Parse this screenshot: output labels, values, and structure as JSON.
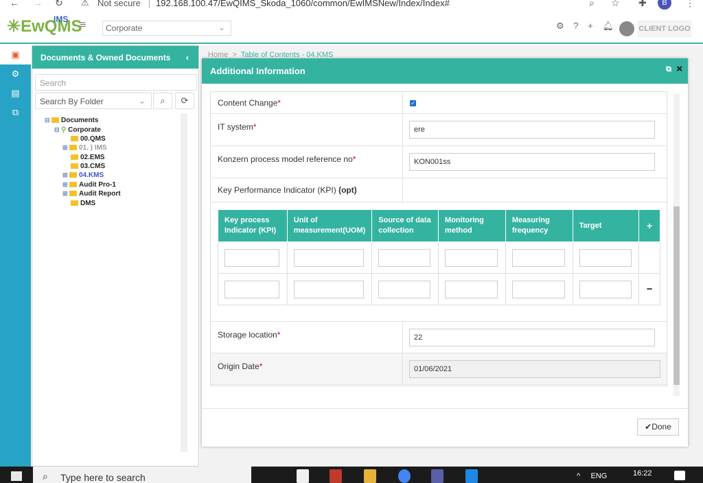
{
  "browser": {
    "back_icon": "←",
    "forward_icon": "→",
    "reload_icon": "↻",
    "security_label": "Not secure",
    "url": "192.168.100.47/EwQIMS_Skoda_1060/common/EwIMSNew/Index/Index#",
    "profile_initial": "B"
  },
  "header": {
    "logo_text": "EwQMS",
    "logo_sup": "IMS",
    "org_select": "Corporate",
    "client_logo": "CLIENT LOGO"
  },
  "docpanel": {
    "title": "Documents & Owned Documents",
    "search_placeholder": "Search",
    "folder_select": "Search By Folder",
    "tree": [
      {
        "label": "Documents"
      },
      {
        "label": "Corporate"
      },
      {
        "label": "00.QMS"
      },
      {
        "label": "01. ) IMS"
      },
      {
        "label": "02.EMS"
      },
      {
        "label": "03.CMS"
      },
      {
        "label": "04.KMS"
      },
      {
        "label": "Audit Pro-1"
      },
      {
        "label": "Audit Report"
      },
      {
        "label": "DMS"
      }
    ]
  },
  "background": {
    "crumb_home": "Home",
    "crumb_sep": ">",
    "crumb_current": "Table of Contents - 04.KMS"
  },
  "modal": {
    "title": "Additional Information",
    "close": "×",
    "fields": {
      "content_change": {
        "label": "Content Change",
        "checked": true
      },
      "it_system": {
        "label": "IT system",
        "value": "ere"
      },
      "konzern": {
        "label": "Konzern process model reference no",
        "value": "KON001ss"
      },
      "kpi": {
        "label": "Key Performance Indicator (KPI)",
        "opt": "(opt)"
      },
      "storage": {
        "label": "Storage location",
        "value": "22"
      },
      "origin_date": {
        "label": "Origin Date",
        "value": "01/06/2021"
      }
    },
    "required_mark": "*",
    "kpi_table": {
      "headers": [
        "Key process Indicator (KPI)",
        "Unit of measurement(UOM)",
        "Source of data collection",
        "Monitoring method",
        "Measuring frequency",
        "Target"
      ],
      "add_symbol": "+",
      "remove_symbol": "−"
    },
    "done_label": "Done"
  },
  "taskbar": {
    "search_placeholder": "Type here to search",
    "language": "ENG",
    "time": "16:22"
  }
}
